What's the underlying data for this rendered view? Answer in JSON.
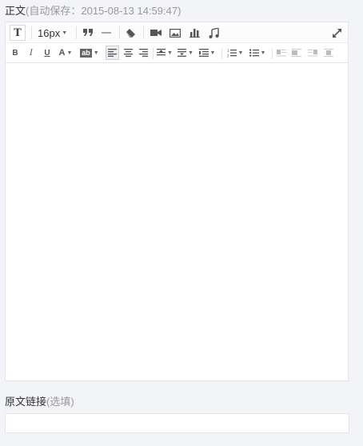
{
  "body_field": {
    "label": "正文",
    "autosave_open": "(",
    "autosave_text": "自动保存：2015-08-13 14:59:47",
    "autosave_close": ")"
  },
  "toolbar": {
    "text_style_glyph": "T",
    "font_size": "16px",
    "bold": "B",
    "italic": "I",
    "underline": "U",
    "font_color": "A",
    "highlight": "ab"
  },
  "icons": [
    "text-style-icon",
    "quote-icon",
    "horizontal-rule-icon",
    "eraser-icon",
    "video-icon",
    "image-icon",
    "chart-icon",
    "music-icon",
    "fullscreen-icon",
    "align-left-icon",
    "align-center-icon",
    "align-right-icon",
    "spacing-top-icon",
    "spacing-bottom-icon",
    "line-height-icon",
    "ordered-list-icon",
    "unordered-list-icon",
    "float-left-icon",
    "float-none-icon",
    "float-right-icon",
    "float-center-icon"
  ],
  "editor": {
    "content": ""
  },
  "link_field": {
    "label": "原文链接",
    "hint_open": "(",
    "hint_text": "选填",
    "hint_close": ")",
    "value": ""
  }
}
